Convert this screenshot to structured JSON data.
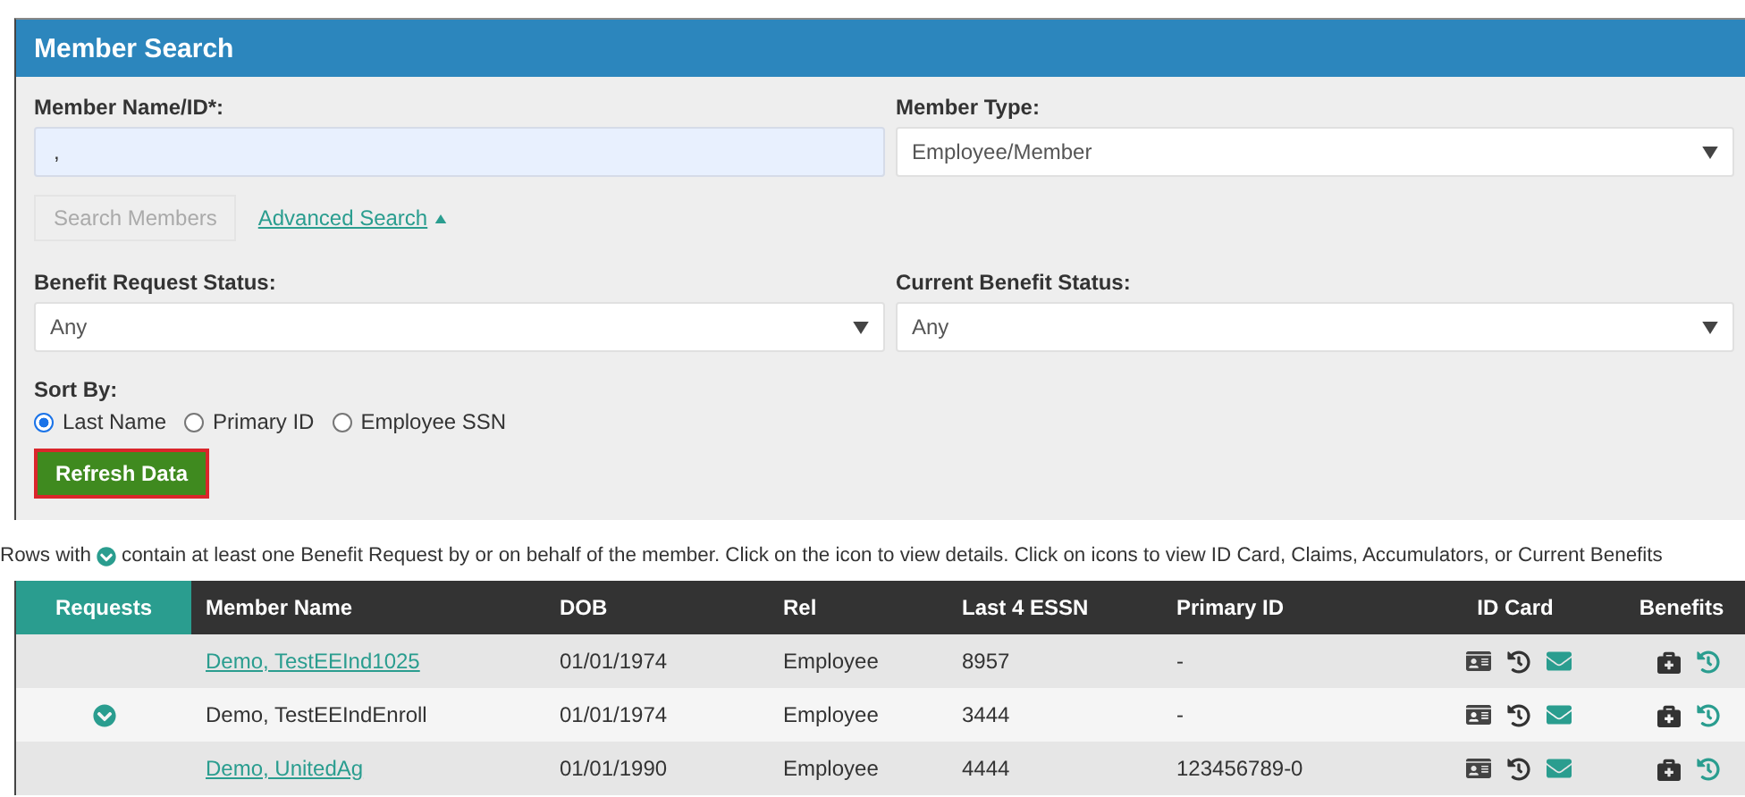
{
  "panel": {
    "title": "Member Search"
  },
  "form": {
    "member_name": {
      "label": "Member Name/ID*:",
      "value": ","
    },
    "member_type": {
      "label": "Member Type:",
      "value": "Employee/Member"
    },
    "search_button": {
      "label": "Search Members",
      "disabled": true
    },
    "advanced_link": {
      "label": "Advanced Search",
      "expanded": true
    },
    "benefit_request_status": {
      "label": "Benefit Request Status:",
      "value": "Any"
    },
    "current_benefit_status": {
      "label": "Current Benefit Status:",
      "value": "Any"
    },
    "sort_by": {
      "label": "Sort By:",
      "options": [
        {
          "label": "Last Name",
          "selected": true
        },
        {
          "label": "Primary ID",
          "selected": false
        },
        {
          "label": "Employee SSN",
          "selected": false
        }
      ]
    },
    "refresh_button": {
      "label": "Refresh Data",
      "highlighted": true
    }
  },
  "note": {
    "before": "Rows with",
    "after": "contain at least one Benefit Request by or on behalf of the member. Click on the icon to view details. Click on icons to view ID Card, Claims, Accumulators, or Current Benefits"
  },
  "table": {
    "columns": [
      "Requests",
      "Member Name",
      "DOB",
      "Rel",
      "Last 4 ESSN",
      "Primary ID",
      "ID Card",
      "Benefits"
    ],
    "rows": [
      {
        "has_request": false,
        "name": "Demo, TestEEInd1025",
        "name_link": true,
        "dob": "01/01/1974",
        "rel": "Employee",
        "last4": "8957",
        "primary_id": "-"
      },
      {
        "has_request": true,
        "name": "Demo, TestEEIndEnroll",
        "name_link": false,
        "dob": "01/01/1974",
        "rel": "Employee",
        "last4": "3444",
        "primary_id": "-"
      },
      {
        "has_request": false,
        "name": "Demo, UnitedAg",
        "name_link": true,
        "dob": "01/01/1990",
        "rel": "Employee",
        "last4": "4444",
        "primary_id": "123456789-0"
      }
    ]
  }
}
